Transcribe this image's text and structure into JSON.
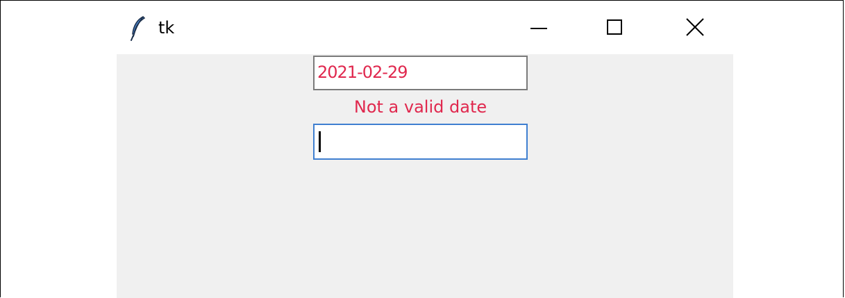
{
  "window": {
    "title": "tk",
    "icon": "feather-icon",
    "controls": {
      "minimize_icon": "minimize-icon",
      "maximize_icon": "maximize-icon",
      "close_icon": "close-icon"
    }
  },
  "form": {
    "date_entry_value": "2021-02-29",
    "error_message": "Not a valid date",
    "second_entry_value": ""
  },
  "colors": {
    "error": "#e0284e",
    "focus_border": "#3f7fd0",
    "client_background": "#f0f0f0"
  }
}
